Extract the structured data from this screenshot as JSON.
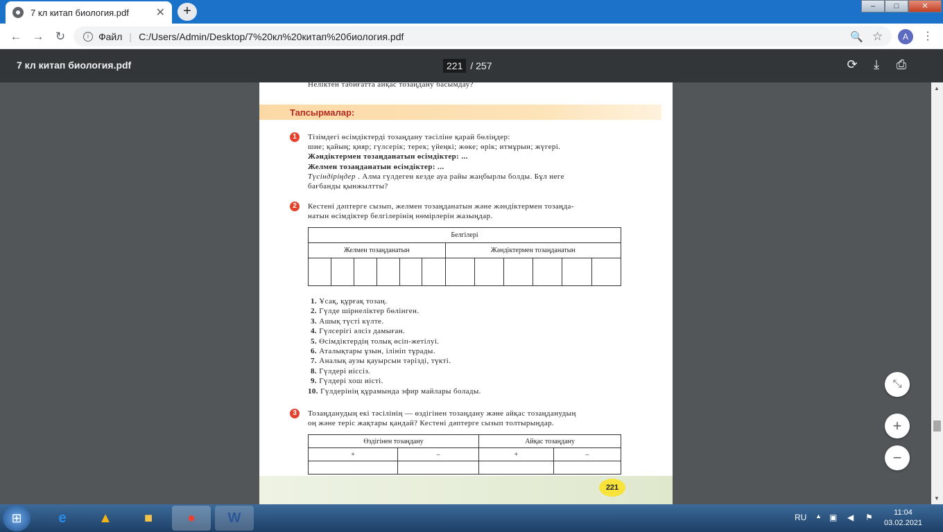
{
  "browser": {
    "tab_title": "7 кл китап биология.pdf",
    "new_tab": "+",
    "window_buttons": {
      "minimize": "–",
      "maximize": "□",
      "close": "✕"
    },
    "back": "←",
    "forward": "→",
    "reload": "↻",
    "site_label": "Файл",
    "url": "C:/Users/Admin/Desktop/7%20кл%20китап%20биология.pdf",
    "zoom_icon": "🔍",
    "star_icon": "☆",
    "avatar_letter": "A",
    "menu_icon": "⋮"
  },
  "pdf_toolbar": {
    "title": "7 кл китап биология.pdf",
    "current_page": "221",
    "total_pages": "/ 257",
    "rotate_icon": "⟳",
    "download_icon": "⤓",
    "print_icon": "⎙"
  },
  "page": {
    "top_line": "Неліктен табиғатта айқас тозаңдану басымдау?",
    "banner": "Тапсырмалар:",
    "task1": {
      "num": "1",
      "l1": "Тізімдегі өсімдіктерді тозаңдану тәсіліне қарай бөліңдер:",
      "l2": "шие; қайың; қияр; гүлсерік; терек; үйеңкі; жөке; өрік; итмұрын; жүгері.",
      "l3": "Жәндіктермен тозаңданатын өсімдіктер: ...",
      "l4": "Желмен тозаңданатын өсімдіктер: ...",
      "l5a": "Түсіндіріңдер",
      "l5b": ". Алма гүлдеген кезде ауа райы жаңбырлы болды. Бұл неге",
      "l6": "бағбанды қынжылтты?"
    },
    "task2": {
      "num": "2",
      "l1": "Кестені дәптерге сызып, желмен тозаңданатын және жәндіктермен тозаңда-",
      "l2": "натын өсімдіктер белгілерінің нөмірлерін жазыңдар.",
      "table_head": "Белгілері",
      "col1": "Желмен тозаңданатын",
      "col2": "Жәндіктермен тозаңданатын"
    },
    "list": [
      {
        "n": "1.",
        "t": "Ұсақ, құрғақ тозаң."
      },
      {
        "n": "2.",
        "t": "Гүлде шірнеліктер бөлінген."
      },
      {
        "n": "3.",
        "t": "Ашық түсті күлте."
      },
      {
        "n": "4.",
        "t": "Гүлсерігі әлсіз дамыған."
      },
      {
        "n": "5.",
        "t": "Өсімдіктердің толық өсіп-жетілуі."
      },
      {
        "n": "6.",
        "t": "Аталықтары ұзын, ілініп тұрады."
      },
      {
        "n": "7.",
        "t": "Аналық аузы қауырсын тәрізді, түкті."
      },
      {
        "n": "8.",
        "t": "Гүлдері иіссіз."
      },
      {
        "n": "9.",
        "t": "Гүлдері хош иісті."
      },
      {
        "n": "10.",
        "t": "Гүлдерінің құрамында эфир майлары болады."
      }
    ],
    "task3": {
      "num": "3",
      "l1": "Тозаңданудың екі тәсілінің — өздігінен тозаңдану және айқас тозаңданудың",
      "l2": "оң және теріс жақтары қандай? Кестені дәптерге сызып толтырыңдар.",
      "col1": "Өздігінен тозаңдану",
      "col2": "Айқас тозаңдану",
      "plus": "+",
      "minus": "–"
    },
    "page_number": "221"
  },
  "zoom": {
    "fit": "⤡",
    "in": "+",
    "out": "−"
  },
  "taskbar": {
    "start": "⊞",
    "lang": "RU",
    "time": "11:04",
    "date": "03.02.2021"
  }
}
